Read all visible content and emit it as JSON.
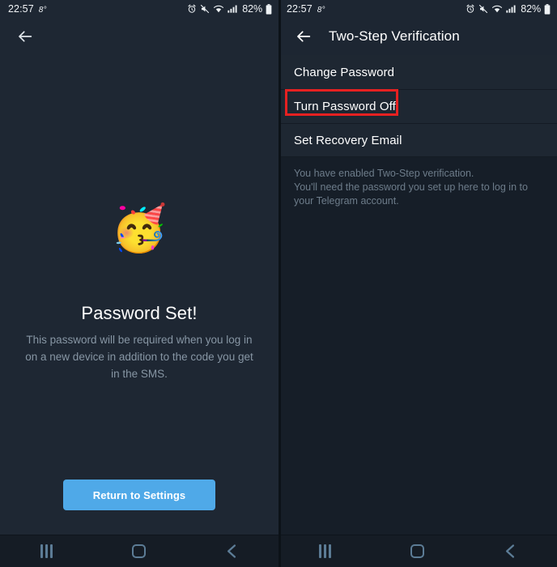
{
  "status_bar": {
    "time": "22:57",
    "temperature": "8°",
    "battery_percent": "82%",
    "icons": [
      "alarm-icon",
      "mute-icon",
      "wifi-icon",
      "signal-icon",
      "battery-icon"
    ]
  },
  "left_panel": {
    "app_bar": {
      "back_icon": "arrow-left-icon",
      "title": ""
    },
    "emoji": "🥳",
    "emoji_name": "partying-face-emoji",
    "title": "Password Set!",
    "subtitle": "This password will be required when you log in on a new device in addition to the code you get in the SMS.",
    "primary_button": "Return to Settings"
  },
  "right_panel": {
    "app_bar": {
      "back_icon": "arrow-left-icon",
      "title": "Two-Step Verification"
    },
    "menu_items": [
      {
        "label": "Change Password",
        "highlighted": false
      },
      {
        "label": "Turn Password Off",
        "highlighted": true
      },
      {
        "label": "Set Recovery Email",
        "highlighted": false
      }
    ],
    "footer_note": "You have enabled Two-Step verification.\nYou'll need the password you set up here to log in to your Telegram account."
  },
  "nav_bar": {
    "recents_label": "recents-button",
    "home_label": "home-button",
    "back_label": "back-button"
  },
  "colors": {
    "accent_blue": "#4fa9e8",
    "annotation_red": "#e62121",
    "panel_left_bg": "#1e2733",
    "panel_right_bg": "#161e28",
    "list_bg": "#1e2732",
    "nav_icon": "#5c7c96"
  }
}
